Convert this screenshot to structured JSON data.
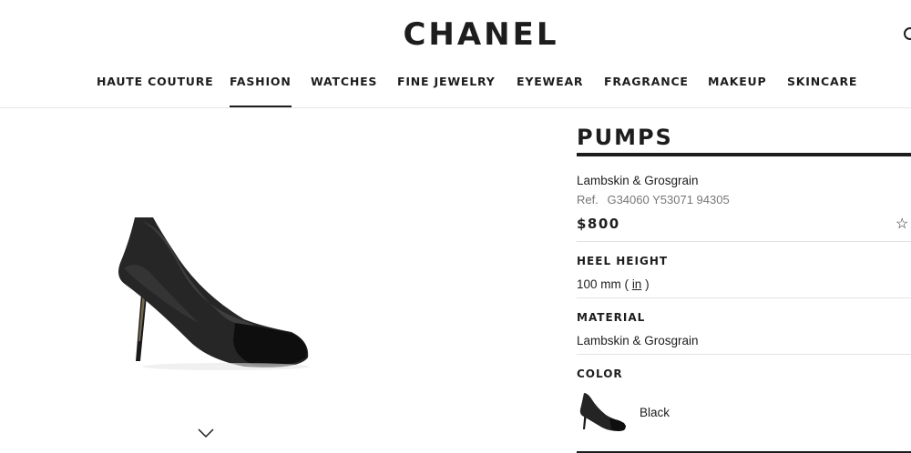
{
  "brand": {
    "logo": "CHANEL"
  },
  "nav": {
    "items": [
      "HAUTE COUTURE",
      "FASHION",
      "WATCHES",
      "FINE JEWELRY",
      "EYEWEAR",
      "FRAGRANCE",
      "MAKEUP",
      "SKINCARE"
    ],
    "active": "FASHION"
  },
  "gallery": {
    "next_icon": "chevron-down-icon"
  },
  "product": {
    "title": "PUMPS",
    "subtitle": "Lambskin & Grosgrain",
    "ref_label": "Ref.",
    "ref_value": "G34060 Y53071 94305",
    "price": "$800",
    "wishlist_icon": "star-icon"
  },
  "heel": {
    "label": "HEEL HEIGHT",
    "value": "100 mm",
    "paren_open": "(",
    "unit_link": "in",
    "paren_close": ")"
  },
  "material": {
    "label": "MATERIAL",
    "value": "Lambskin & Grosgrain"
  },
  "color": {
    "label": "COLOR",
    "name": "Black",
    "swatch_hex": "#1d1d1d"
  }
}
